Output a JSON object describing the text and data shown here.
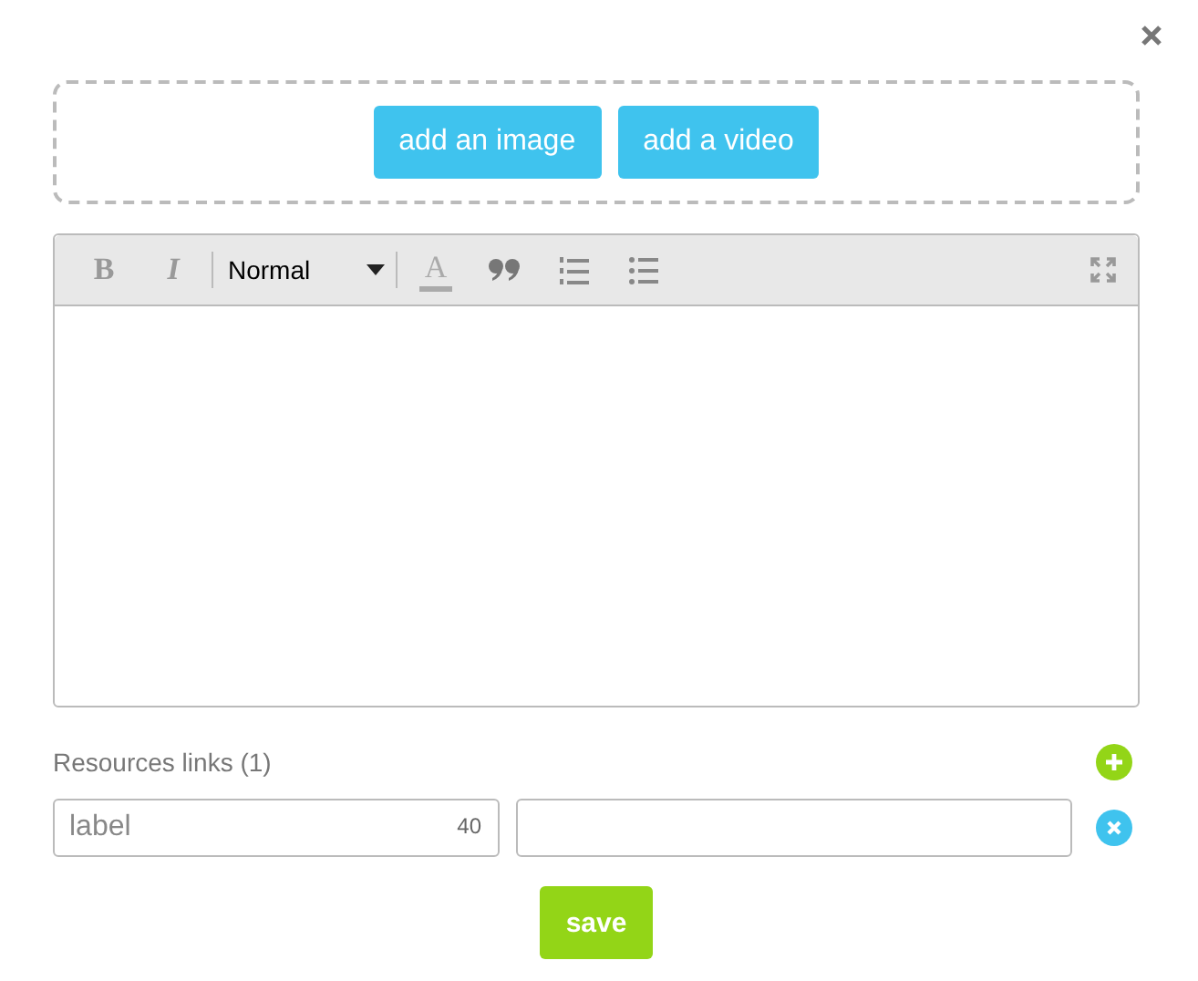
{
  "media_buttons": [
    "add an image",
    "add a video"
  ],
  "editor": {
    "toolbar": [
      {
        "kind": "bold",
        "label": "B"
      },
      {
        "kind": "italic",
        "label": "I"
      },
      {
        "kind": "format",
        "value": "Normal"
      },
      {
        "kind": "color",
        "label": "A"
      },
      {
        "kind": "quote"
      },
      {
        "kind": "ordered-list"
      },
      {
        "kind": "bullet-list"
      }
    ]
  },
  "resources": {
    "title": "Resources links (1)",
    "links": [
      {
        "placeholder": "label",
        "counter": "40"
      }
    ]
  },
  "save": "save"
}
